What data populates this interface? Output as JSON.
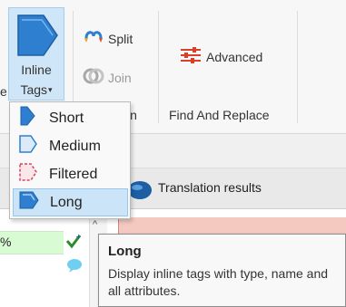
{
  "ribbon": {
    "cut_label": "e",
    "inline_tags": {
      "line1": "Inline",
      "line2": "Tags",
      "caret": "▾",
      "icon": "inline-tags-large-icon"
    },
    "split": {
      "label": "Split",
      "icon": "split-icon"
    },
    "join": {
      "label": "Join",
      "icon": "join-icon"
    },
    "advanced": {
      "label": "Advanced",
      "icon": "advanced-icon"
    },
    "groups": {
      "merge_fragment": "in",
      "find_and_replace": "Find And Replace"
    }
  },
  "dropdown": {
    "items": [
      {
        "label": "Short",
        "icon": "short-tag-icon"
      },
      {
        "label": "Medium",
        "icon": "medium-tag-icon"
      },
      {
        "label": "Filtered",
        "icon": "filtered-tag-icon"
      },
      {
        "label": "Long",
        "icon": "long-tag-icon",
        "selected": true
      }
    ]
  },
  "translation_results": {
    "label": "Translation results"
  },
  "grid": {
    "percent": "%",
    "scroll_up": "^"
  },
  "tooltip": {
    "title": "Long",
    "body": "Display inline tags with type, name and all attributes."
  },
  "colors": {
    "accent_selected": "#cce4f7",
    "button_pressed": "#cfe6f8",
    "match_green": "#d9fbd3",
    "results_pane": "#f4c9c0",
    "tag_icon_blue": "#2f7fd0",
    "status_green": "#2e8b2e"
  }
}
